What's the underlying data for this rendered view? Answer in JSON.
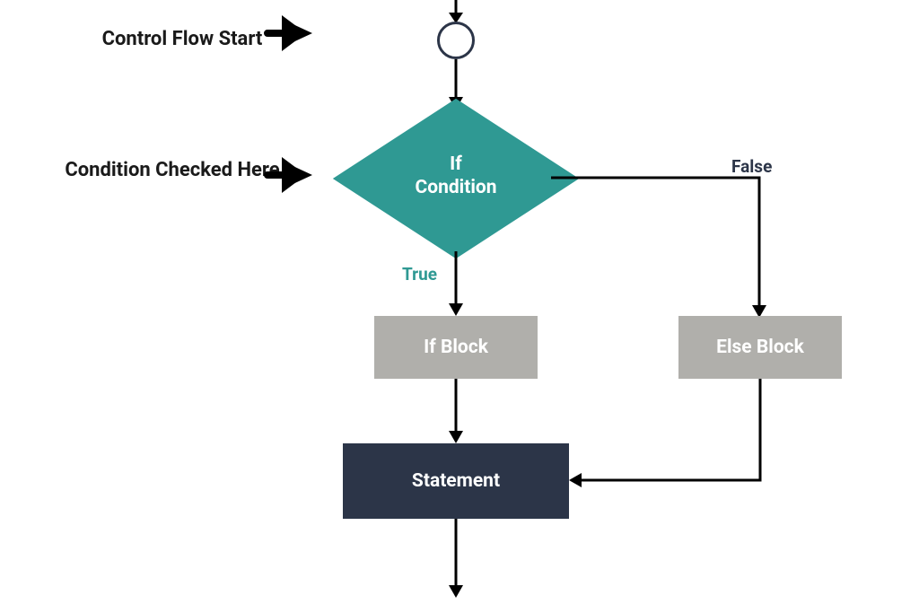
{
  "annotations": {
    "control_flow_start": "Control Flow Start",
    "condition_checked": "Condition Checked Here"
  },
  "nodes": {
    "decision": {
      "line1": "If",
      "line2": "Condition"
    },
    "if_block": "If Block",
    "else_block": "Else Block",
    "statement": "Statement"
  },
  "branches": {
    "true": "True",
    "false": "False"
  },
  "colors": {
    "teal": "#2f9993",
    "dark": "#2c3548",
    "gray": "#b0afab",
    "black": "#000000"
  }
}
